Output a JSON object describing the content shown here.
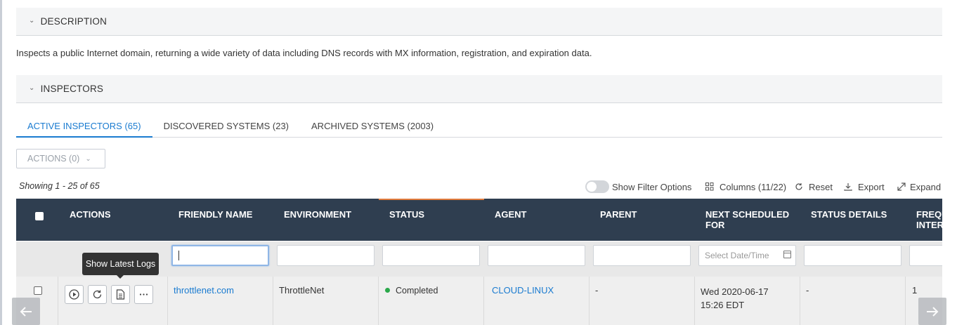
{
  "sections": {
    "description_title": "DESCRIPTION",
    "description_text": "Inspects a public Internet domain, returning a wide variety of data including DNS records with MX information, registration, and expiration data.",
    "inspectors_title": "INSPECTORS"
  },
  "tabs": [
    {
      "label": "ACTIVE INSPECTORS (65)",
      "active": true
    },
    {
      "label": "DISCOVERED SYSTEMS (23)",
      "active": false
    },
    {
      "label": "ARCHIVED SYSTEMS (2003)",
      "active": false
    }
  ],
  "actions_button": "ACTIONS (0)",
  "showing": "Showing 1 - 25 of 65",
  "toolbar": {
    "filter_toggle": "Show Filter Options",
    "columns": "Columns (11/22)",
    "reset": "Reset",
    "export": "Export",
    "expand": "Expand"
  },
  "columns": [
    "ACTIONS",
    "FRIENDLY NAME",
    "ENVIRONMENT",
    "STATUS",
    "AGENT",
    "PARENT",
    "NEXT SCHEDULED FOR",
    "STATUS DETAILS",
    "FREQUENCY INTERVAL"
  ],
  "columns_visible": {
    "actions": "ACTIONS",
    "friendly_name": "FRIENDLY NAME",
    "environment": "ENVIRONMENT",
    "status": "STATUS",
    "agent": "AGENT",
    "parent": "PARENT",
    "next_line1": "NEXT SCHEDULED",
    "next_line2": "FOR",
    "status_details": "STATUS DETAILS",
    "freq_line1": "FREQU",
    "freq_line2": "INTER"
  },
  "filters": {
    "date_placeholder": "Select Date/Time"
  },
  "row": {
    "friendly_name": "throttlenet.com",
    "environment": "ThrottleNet",
    "status": "Completed",
    "status_color": "#2aa84a",
    "agent": "CLOUD-LINUX",
    "parent": "-",
    "next_line1": "Wed 2020-06-17",
    "next_line2": "15:26 EDT",
    "status_details": "-",
    "frequency": "1"
  },
  "tooltip": "Show Latest Logs",
  "icons": {
    "play": "play-circle-icon",
    "refresh": "refresh-icon",
    "logs": "document-icon",
    "more": "ellipsis-icon"
  },
  "colors": {
    "header_bg": "#2f3e50",
    "accent": "#1a7bd0",
    "status_highlight": "#e07a3c"
  }
}
